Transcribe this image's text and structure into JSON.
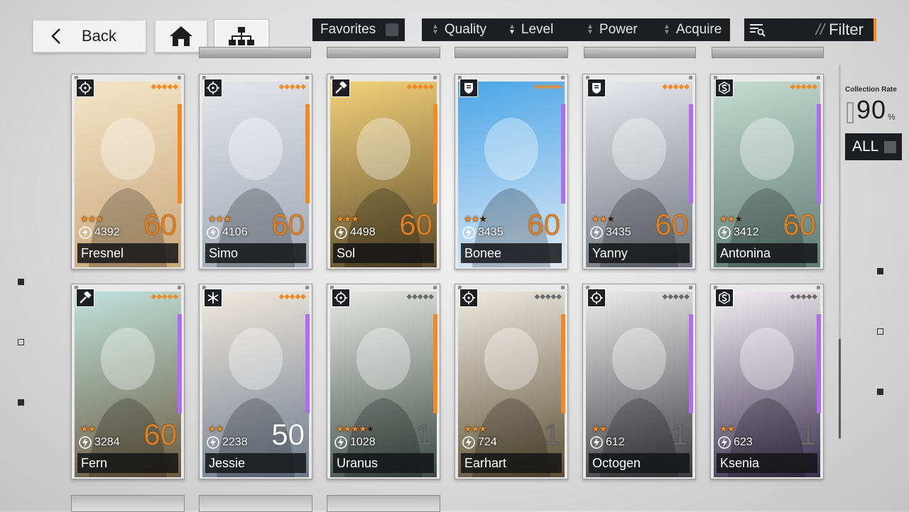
{
  "topbar": {
    "back_label": "Back",
    "home_icon": "home-icon",
    "hierarchy_icon": "sitemap-icon",
    "favorites_label": "Favorites",
    "sort": [
      {
        "label": "Quality",
        "active": false
      },
      {
        "label": "Level",
        "active": true
      },
      {
        "label": "Power",
        "active": false
      },
      {
        "label": "Acquire",
        "active": false
      }
    ],
    "filter_prefix": "//",
    "filter_label": "Filter"
  },
  "sidepanel": {
    "collection_label": "Collection Rate",
    "collection_value": "90",
    "collection_unit": "%",
    "all_label": "ALL"
  },
  "colors": {
    "accent_orange": "#f08a24",
    "accent_purple": "#b06ef0",
    "dark_panel": "#1c1e22"
  },
  "characters": [
    {
      "name": "Fresnel",
      "power": "4392",
      "level": "60",
      "stars": 3,
      "max_stars": 3,
      "class_icon": "crosshair-icon",
      "rarity_color": "#f08a24",
      "level_style": "o",
      "bg": [
        "#f4e5c8",
        "#c9a77a"
      ]
    },
    {
      "name": "Simo",
      "power": "4106",
      "level": "60",
      "stars": 3,
      "max_stars": 3,
      "class_icon": "crosshair-icon",
      "rarity_color": "#f08a24",
      "level_style": "o",
      "bg": [
        "#e3e6ea",
        "#9ea6b2"
      ]
    },
    {
      "name": "Sol",
      "power": "4498",
      "level": "60",
      "stars": 3,
      "max_stars": 3,
      "class_icon": "hammer-icon",
      "rarity_color": "#f08a24",
      "level_style": "o",
      "bg": [
        "#f4d27a",
        "#5a4a2a"
      ]
    },
    {
      "name": "Bonee",
      "power": "3435",
      "level": "60",
      "stars": 2,
      "max_stars": 3,
      "class_icon": "shield-icon",
      "rarity_color": "#b06ef0",
      "level_style": "o",
      "bg": [
        "#4aa6e8",
        "#dfe9f4"
      ]
    },
    {
      "name": "Yanny",
      "power": "3435",
      "level": "60",
      "stars": 2,
      "max_stars": 3,
      "class_icon": "shield-icon",
      "rarity_color": "#b06ef0",
      "level_style": "o",
      "bg": [
        "#e9eaee",
        "#6f747e"
      ]
    },
    {
      "name": "Antonina",
      "power": "3412",
      "level": "60",
      "stars": 2,
      "max_stars": 3,
      "class_icon": "dollar-icon",
      "rarity_color": "#b06ef0",
      "level_style": "o",
      "bg": [
        "#c4dcd2",
        "#5f7a72"
      ]
    },
    {
      "name": "Fern",
      "power": "3284",
      "level": "60",
      "stars": 2,
      "max_stars": 2,
      "class_icon": "hammer-icon",
      "rarity_color": "#b06ef0",
      "level_style": "o",
      "bg": [
        "#bfe2dc",
        "#6b5a3f"
      ]
    },
    {
      "name": "Jessie",
      "power": "2238",
      "level": "50",
      "stars": 2,
      "max_stars": 2,
      "class_icon": "snowflake-icon",
      "rarity_color": "#b06ef0",
      "level_style": "w",
      "bg": [
        "#f1e9de",
        "#6d7a8c"
      ]
    },
    {
      "name": "Uranus",
      "power": "1028",
      "level": "1",
      "stars": 4,
      "max_stars": 5,
      "class_icon": "crosshair-icon",
      "rarity_color": "#f08a24",
      "level_style": "g",
      "bg": [
        "#e8e8e6",
        "#3c4a44"
      ]
    },
    {
      "name": "Earhart",
      "power": "724",
      "level": "1",
      "stars": 3,
      "max_stars": 3,
      "class_icon": "crosshair-icon",
      "rarity_color": "#f08a24",
      "level_style": "g",
      "bg": [
        "#eeeae2",
        "#5c5034"
      ]
    },
    {
      "name": "Octogen",
      "power": "612",
      "level": "1",
      "stars": 2,
      "max_stars": 2,
      "class_icon": "crosshair-icon",
      "rarity_color": "#b06ef0",
      "level_style": "g",
      "bg": [
        "#ecebeb",
        "#3b3b3f"
      ]
    },
    {
      "name": "Ksenia",
      "power": "623",
      "level": "1",
      "stars": 2,
      "max_stars": 2,
      "class_icon": "dollar-icon",
      "rarity_color": "#b06ef0",
      "level_style": "g",
      "bg": [
        "#f2eef1",
        "#3a2f4e"
      ]
    }
  ]
}
